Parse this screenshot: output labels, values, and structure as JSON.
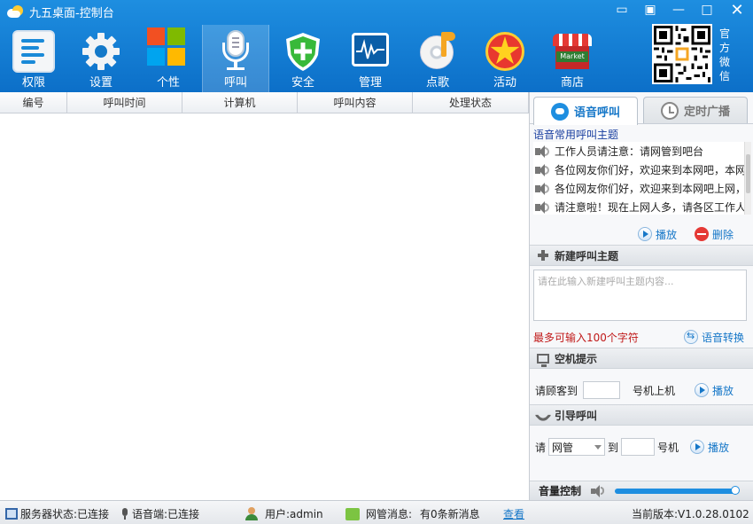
{
  "window": {
    "title": "九五桌面-控制台",
    "controls": {
      "feedback": "▭",
      "shirt": "▣",
      "minimize": "—",
      "maximize": "□",
      "close": "✕"
    }
  },
  "nav": {
    "items": [
      {
        "id": "perm",
        "label": "权限",
        "icon": "permission-list-icon"
      },
      {
        "id": "settings",
        "label": "设置",
        "icon": "gear-icon"
      },
      {
        "id": "personal",
        "label": "个性",
        "icon": "windows-logo-icon"
      },
      {
        "id": "call",
        "label": "呼叫",
        "icon": "microphone-icon",
        "active": true
      },
      {
        "id": "security",
        "label": "安全",
        "icon": "shield-icon"
      },
      {
        "id": "manage",
        "label": "管理",
        "icon": "monitor-icon"
      },
      {
        "id": "song",
        "label": "点歌",
        "icon": "music-disc-icon"
      },
      {
        "id": "activity",
        "label": "活动",
        "icon": "star-icon"
      },
      {
        "id": "store",
        "label": "商店",
        "icon": "market-icon"
      }
    ],
    "market_sign": "Market",
    "qr_caption": [
      "官",
      "方",
      "微",
      "信"
    ]
  },
  "table": {
    "columns": [
      "编号",
      "呼叫时间",
      "计算机",
      "呼叫内容",
      "处理状态"
    ],
    "rows": []
  },
  "panel": {
    "tabs": {
      "voice": "语音呼叫",
      "timed": "定时广播"
    },
    "common_title": "语音常用呼叫主题",
    "topics": [
      "工作人员请注意：请网管到吧台",
      "各位网友你们好，欢迎来到本网吧，本网吧",
      "各位网友你们好，欢迎来到本网吧上网，请",
      "请注意啦！现在上网人多，请各区工作人员"
    ],
    "play_label": "播放",
    "delete_label": "删除",
    "new_topic": {
      "header": "新建呼叫主题",
      "placeholder": "请在此输入新建呼叫主题内容...",
      "limit_text": "最多可输入100个字符",
      "convert_label": "语音转换"
    },
    "idle": {
      "header": "空机提示",
      "prefix": "请顾客到",
      "suffix": "号机上机",
      "play_label": "播放"
    },
    "guide": {
      "header": "引导呼叫",
      "prefix": "请",
      "selected": "网管",
      "to": "到",
      "suffix": "号机",
      "play_label": "播放"
    },
    "volume": {
      "label": "音量控制",
      "level": 1.0
    }
  },
  "status": {
    "server": "服务器状态:已连接",
    "voice": "语音端:已连接",
    "user": "用户:admin",
    "msg_label": "网管消息:",
    "msg_value": "有0条新消息",
    "view": "查看",
    "version": "当前版本:V1.0.28.0102"
  },
  "colors": {
    "header": "#1a86d8",
    "accent": "#1677c8",
    "warning": "#c01818"
  }
}
